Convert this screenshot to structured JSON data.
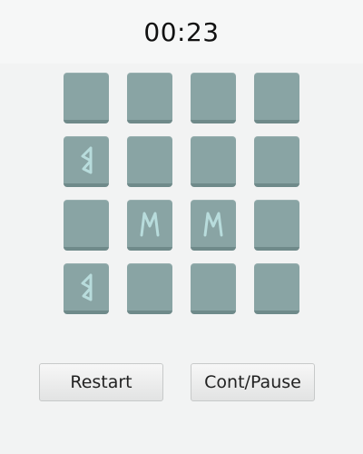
{
  "timer": {
    "text": "00:23"
  },
  "board": {
    "rows": 4,
    "cols": 4,
    "tiles": [
      {
        "symbol": "hidden"
      },
      {
        "symbol": "hidden"
      },
      {
        "symbol": "hidden"
      },
      {
        "symbol": "hidden"
      },
      {
        "symbol": "rune-arrow"
      },
      {
        "symbol": "hidden"
      },
      {
        "symbol": "hidden"
      },
      {
        "symbol": "hidden"
      },
      {
        "symbol": "hidden"
      },
      {
        "symbol": "rune-m"
      },
      {
        "symbol": "rune-m"
      },
      {
        "symbol": "hidden"
      },
      {
        "symbol": "rune-arrow"
      },
      {
        "symbol": "hidden"
      },
      {
        "symbol": "hidden"
      },
      {
        "symbol": "hidden"
      }
    ]
  },
  "controls": {
    "restart_label": "Restart",
    "pause_label": "Cont/Pause"
  },
  "colors": {
    "background": "#f2f3f3",
    "tile": "#89a4a4",
    "tile_shadow": "#6f8a8a",
    "rune": "#b8dcdc"
  }
}
